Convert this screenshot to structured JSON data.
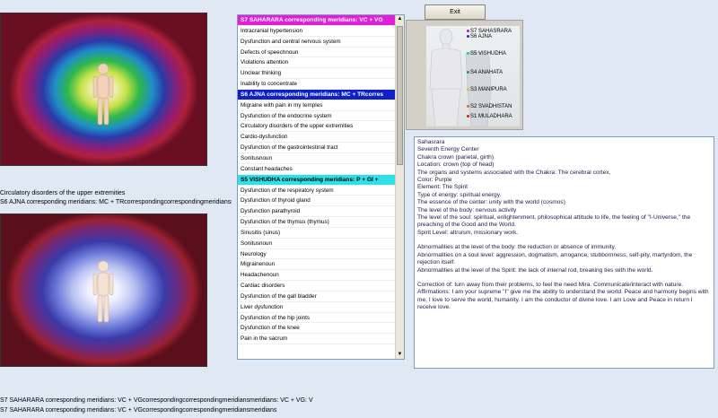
{
  "exit_label": "Exit",
  "caption_under_top_image": [
    "Circulatory disorders of the upper extremities",
    "S6 AJNA corresponding meridians: MC + TRcorrespondingcorrespondingmeridiansmeridia"
  ],
  "bottom_status": [
    "S7 SAHARARA corresponding meridians: VC + VGcorrespondingcorrespondingmeridiansmeridians: VC + VG: V",
    "S7 SAHARARA corresponding meridians: VC + VGcorrespondingcorrespondingmeridiansmeridians"
  ],
  "symptom_list": [
    {
      "text": "S7 SAHARARA corresponding meridians: VC + VG",
      "header": true,
      "bg": "#e020d8",
      "fg": "#ffffff"
    },
    {
      "text": "Intracranial hypertension"
    },
    {
      "text": "Dysfunction and central nervous system"
    },
    {
      "text": "Defects of speechnoun"
    },
    {
      "text": "Violations attention"
    },
    {
      "text": "Unclear thinking"
    },
    {
      "text": "Inability to concentrate"
    },
    {
      "text": "S6 AJNA corresponding meridians: MC + TRcorres",
      "header": true,
      "bg": "#1020c8",
      "fg": "#ffffff"
    },
    {
      "text": "Migraine with pain in my temples"
    },
    {
      "text": "Dysfunction of the endocrine system"
    },
    {
      "text": "Circulatory disorders of the upper extremities"
    },
    {
      "text": "Cardio-dysfunction"
    },
    {
      "text": "Dysfunction of the gastrointestinal tract"
    },
    {
      "text": "Sonitusnoun"
    },
    {
      "text": "Constant headaches"
    },
    {
      "text": "S5 VISHUDHA corresponding meridians: P + GI +",
      "header": true,
      "bg": "#30e0e8",
      "fg": "#000000"
    },
    {
      "text": "Dysfunction of the respiratory system"
    },
    {
      "text": "Dysfunction of thyroid gland"
    },
    {
      "text": "Dysfunction parathyroid"
    },
    {
      "text": "Dysfunction of the thymus (thymus)"
    },
    {
      "text": "Sinusitis (sinus)"
    },
    {
      "text": "Sonitusnoun"
    },
    {
      "text": "Neurology"
    },
    {
      "text": "Migrainenoun"
    },
    {
      "text": "Headachenoun"
    },
    {
      "text": "Cardiac disorders"
    },
    {
      "text": "Dysfunction of the gall bladder"
    },
    {
      "text": "Liver dysfunction"
    },
    {
      "text": "Dysfunction of the hip joints"
    },
    {
      "text": "Dysfunction of the knee"
    },
    {
      "text": "Pain in the sacrum"
    }
  ],
  "chakra_checkboxes": [
    {
      "label": "S7 SAHASRARA",
      "color": "#b020c0"
    },
    {
      "label": "S6 AJNA",
      "color": "#2030c0"
    },
    {
      "label": "S5 VISHUDHA",
      "color": "#20c0d0"
    },
    {
      "label": "S4 ANAHATA",
      "color": "#20a040"
    },
    {
      "label": "S3 MANIPURA",
      "color": "#e0c020"
    },
    {
      "label": "S2 SVADHISTAN",
      "color": "#e07020"
    },
    {
      "label": "S1 MULADHARA",
      "color": "#d02020"
    }
  ],
  "description": {
    "lines": [
      "Sahasrara",
      "Seventh Energy Center",
      "Chakra crown (parietal, girth)",
      "Location: crown (top of head)",
      "The organs and systems associated with the Chakra: The cerebral cortex,",
      "Color: Purple",
      "Element: The Spirit",
      "Type of energy: spiritual energy.",
      "The essence of the center: unity with the world (cosmos)",
      "The level of the body: nervous activity",
      "The level of the soul: spiritual, enlightenment, philosophical attitude to life, the feeling of \"I-Universe,\" the preaching of the Good and the World.",
      "Spirit Level: altruism, missionary work."
    ],
    "abnormalities": [
      "Abnormalities at the level of the body: the reduction or absence of immunity.",
      "Abnormalities on a soul level: aggression, dogmatism, arrogance, stubbornness, self-pity, martyrdom, the rejection itself.",
      "Abnormalities at the level of the Spirit: the lack of internal rod, breaking ties with the world."
    ],
    "correction": "Correction of: turn away from their problems, to feel the need Mira. Communicate/interact with nature. Affirmations: I am your supreme \"I\" give me the ability to understand the world. Peace and harmony begins with me, I love to serve the world, humanity. I am the conductor of divine love. I am Love and Peace in return I receive love."
  }
}
